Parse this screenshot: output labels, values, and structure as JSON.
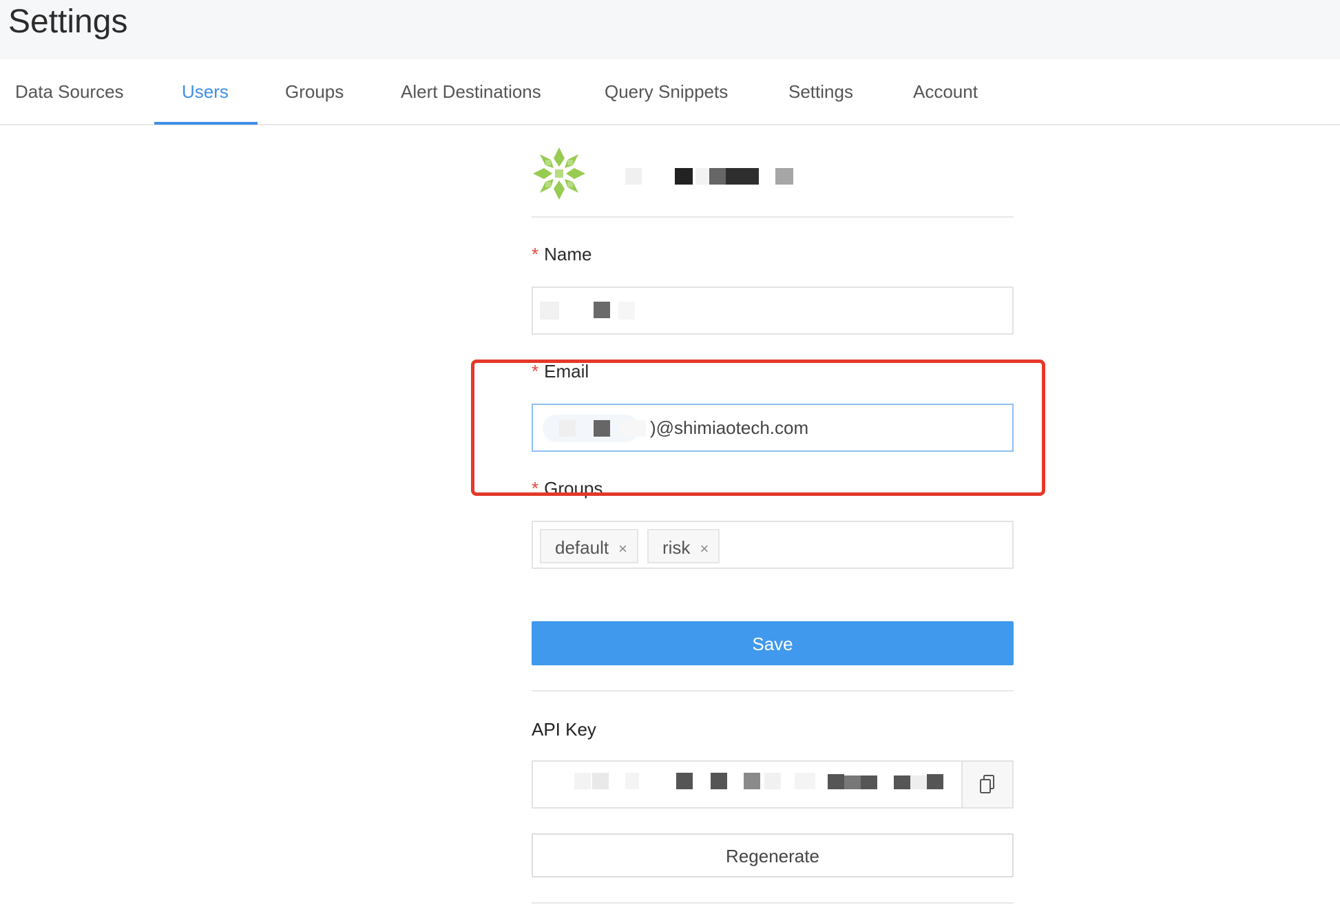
{
  "header": {
    "title": "Settings"
  },
  "tabs": [
    {
      "label": "Data Sources",
      "active": false
    },
    {
      "label": "Users",
      "active": true
    },
    {
      "label": "Groups",
      "active": false
    },
    {
      "label": "Alert Destinations",
      "active": false
    },
    {
      "label": "Query Snippets",
      "active": false
    },
    {
      "label": "Settings",
      "active": false
    },
    {
      "label": "Account",
      "active": false
    }
  ],
  "form": {
    "required_marker": "*",
    "name": {
      "label": "Name"
    },
    "email": {
      "label": "Email",
      "visible_value": ")@shimiaotech.com"
    },
    "groups": {
      "label": "Groups",
      "tags": [
        {
          "label": "default",
          "remove_glyph": "×"
        },
        {
          "label": "risk",
          "remove_glyph": "×"
        }
      ]
    },
    "save_label": "Save"
  },
  "api_key": {
    "label": "API Key",
    "copy_icon": "copy-icon",
    "regenerate_label": "Regenerate"
  },
  "colors": {
    "accent": "#4099ed",
    "active_tab": "#3f8fe8",
    "required": "#e8453c",
    "highlight": "#e4392a",
    "header_bg": "#f6f7f9"
  }
}
